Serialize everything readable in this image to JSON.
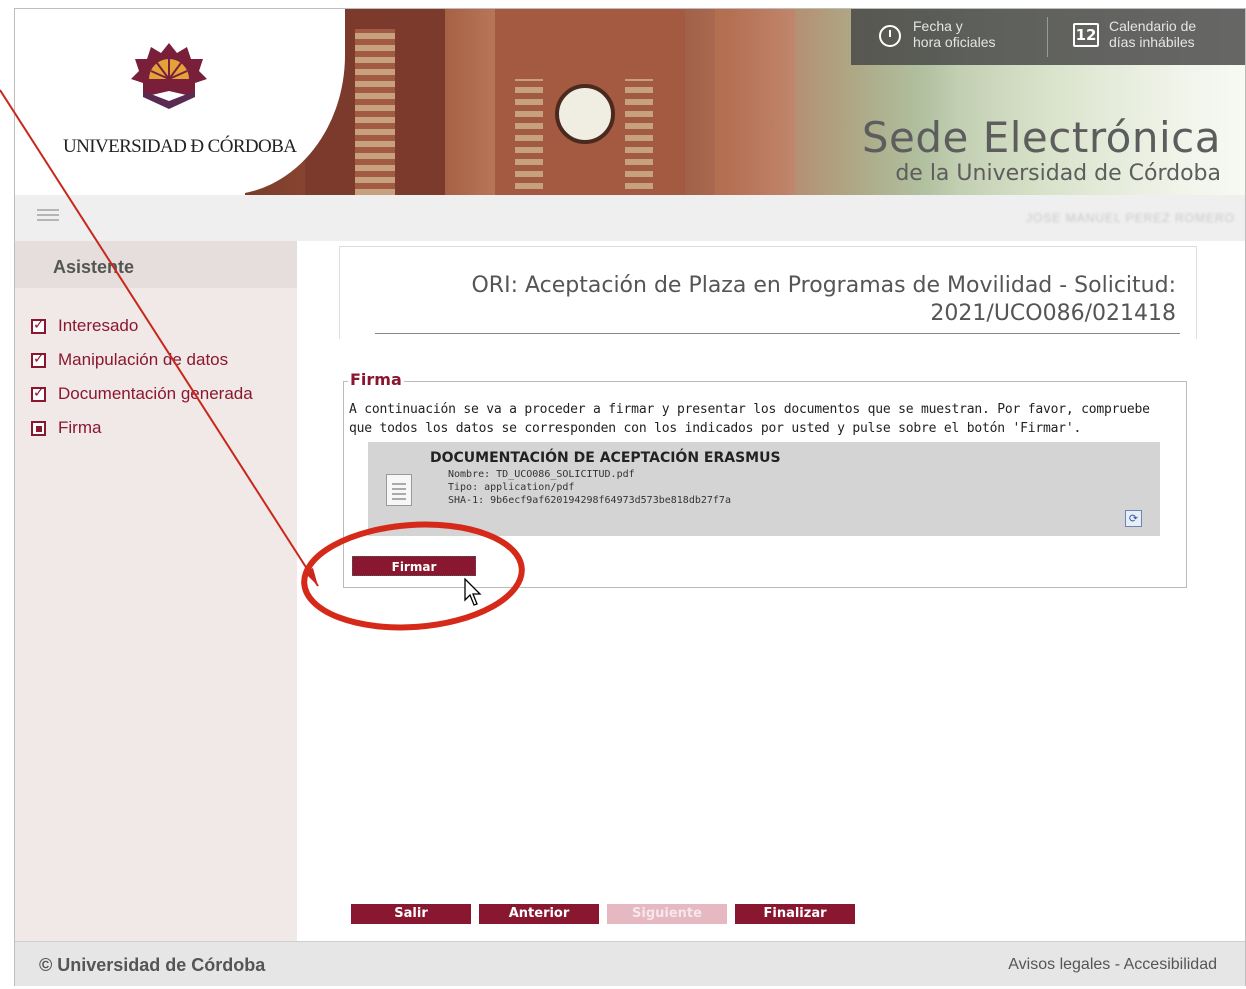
{
  "header": {
    "logo_text": "UNIVERSIDAD Ð CÓRDOBA",
    "fecha_label_1": "Fecha y",
    "fecha_label_2": "hora oficiales",
    "calendar_day": "12",
    "calendario_label_1": "Calendario de",
    "calendario_label_2": "días inhábiles",
    "sede_title": "Sede Electrónica",
    "sede_subtitle": "de la Universidad de Córdoba"
  },
  "navbar": {
    "user_name": "JOSE MANUEL PEREZ ROMERO"
  },
  "sidebar": {
    "title": "Asistente",
    "steps": [
      {
        "label": "Interesado",
        "state": "checked"
      },
      {
        "label": "Manipulación de datos",
        "state": "checked"
      },
      {
        "label": "Documentación generada",
        "state": "checked"
      },
      {
        "label": "Firma",
        "state": "active"
      }
    ]
  },
  "main": {
    "title_line1": "ORI: Aceptación de Plaza en Programas de Movilidad - Solicitud:",
    "title_line2": "2021/UCO086/021418",
    "firma": {
      "legend": "Firma",
      "description": "A continuación se va a proceder a firmar y presentar los documentos que se muestran. Por favor, compruebe que todos los datos se corresponden con los indicados por usted y pulse sobre el botón 'Firmar'.",
      "document": {
        "title": "DOCUMENTACIÓN DE ACEPTACIÓN ERASMUS",
        "nombre": "Nombre: TD_UCO086_SOLICITUD.pdf",
        "tipo": "Tipo: application/pdf",
        "sha": "SHA-1: 9b6ecf9af620194298f64973d573be818db27f7a"
      },
      "button_label": "Firmar"
    },
    "nav_buttons": {
      "salir": "Salir",
      "anterior": "Anterior",
      "siguiente": "Siguiente",
      "finalizar": "Finalizar"
    }
  },
  "footer": {
    "copyright": "© Universidad de Córdoba",
    "links": "Avisos legales - Accesibilidad"
  },
  "colors": {
    "brand": "#8a1730",
    "annotation": "#d52a1a"
  }
}
